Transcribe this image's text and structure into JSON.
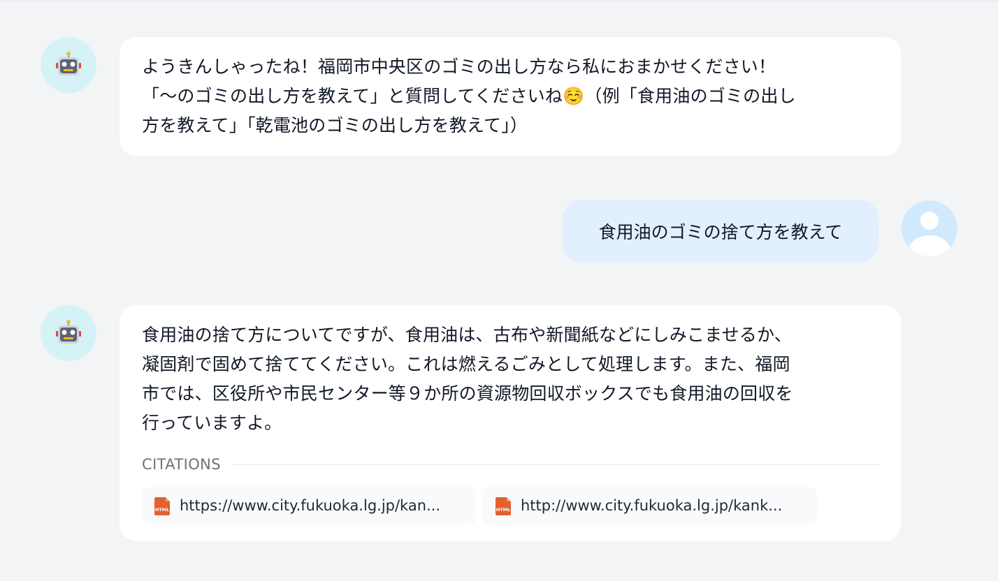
{
  "messages": [
    {
      "role": "bot",
      "text": "ようきんしゃったね！福岡市中央区のゴミの出し方なら私におまかせください！\n「〜のゴミの出し方を教えて」と質問してくださいね☺️（例「食用油のゴミの出し\n方を教えて」「乾電池のゴミの出し方を教えて」）"
    },
    {
      "role": "user",
      "text": "食用油のゴミの捨て方を教えて"
    },
    {
      "role": "bot",
      "text": "食用油の捨て方についてですが、食用油は、古布や新聞紙などにしみこませるか、\n凝固剤で固めて捨ててください。これは燃えるごみとして処理します。また、福岡\n市では、区役所や市民センター等９か所の資源物回収ボックスでも食用油の回収を\n行っていますよ。",
      "citations_label": "CITATIONS",
      "citations": [
        {
          "url": "https://www.city.fukuoka.lg.jp/kan...",
          "icon": "html-file-icon",
          "badge": "HTML"
        },
        {
          "url": "http://www.city.fukuoka.lg.jp/kank...",
          "icon": "html-file-icon",
          "badge": "HTML"
        }
      ]
    }
  ],
  "icons": {
    "bot_avatar": "robot-icon",
    "user_avatar": "user-icon"
  },
  "colors": {
    "background": "#f3f4f6",
    "bot_bubble": "#ffffff",
    "user_bubble": "#e1effe",
    "bot_avatar_bg": "#d5f3f6",
    "user_avatar_bg": "#d1e9fd",
    "html_icon": "#e3602f"
  }
}
